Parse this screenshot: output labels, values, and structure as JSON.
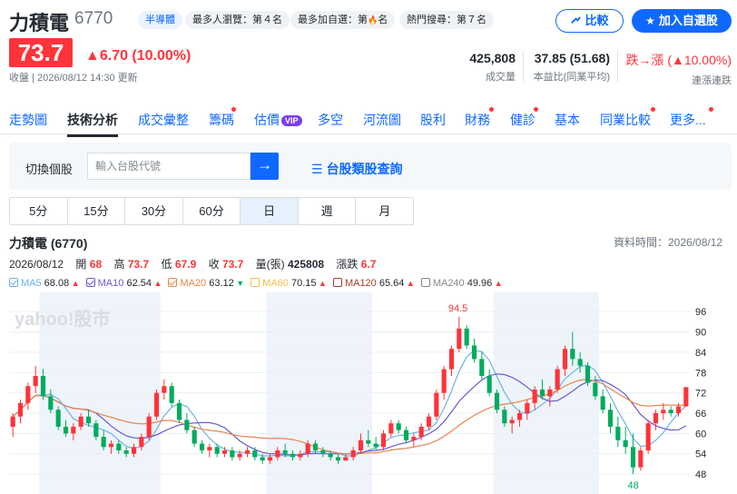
{
  "header": {
    "name": "力積電",
    "ticker": "6770",
    "badges": [
      "半導體",
      "最多人瀏覽：第４名",
      "最多加自選：第",
      "名",
      "熱門搜尋：第７名"
    ],
    "badge_fire_rank": "🔥",
    "compare_label": "比較",
    "watch_label": "加入自選股"
  },
  "quote": {
    "price": "73.7",
    "change": "▲6.70 (10.00%)",
    "close_info": "收盤 | 2026/08/12 14:30 更新",
    "stats": [
      {
        "value": "425,808",
        "label": "成交量"
      },
      {
        "value": "37.85 (51.68)",
        "label": "本益比(同業平均)"
      },
      {
        "value": "跌→漲 (▲10.00%)",
        "label": "連漲連跌"
      }
    ]
  },
  "tabs": [
    "走勢圖",
    "技術分析",
    "成交彙整",
    "籌碼",
    "估價",
    "多空",
    "河流圖",
    "股利",
    "財務",
    "健診",
    "基本",
    "同業比較",
    "更多..."
  ],
  "vip_label": "VIP",
  "search": {
    "label": "切換個股",
    "placeholder": "輸入台股代號",
    "category_link": "台股類股查詢"
  },
  "periods": [
    "5分",
    "15分",
    "30分",
    "60分",
    "日",
    "週",
    "月"
  ],
  "active_period": "日",
  "chart_info": {
    "title": "力積電 (6770)",
    "data_time": "資料時間：2026/08/12",
    "date": "2026/08/12",
    "open_label": "開",
    "open": "68",
    "high_label": "高",
    "high": "73.7",
    "low_label": "低",
    "low": "67.9",
    "close_label": "收",
    "close": "73.7",
    "volume_label": "量(張)",
    "volume": "425808",
    "change_label": "漲跌",
    "change": "6.7"
  },
  "ma_legend": [
    {
      "name": "MA5",
      "value": "68.08",
      "trend": "up",
      "color": "#6cb4e4",
      "checked": true
    },
    {
      "name": "MA10",
      "value": "62.54",
      "trend": "up",
      "color": "#6a5acd",
      "checked": true
    },
    {
      "name": "MA20",
      "value": "63.12",
      "trend": "down",
      "color": "#e4864c",
      "checked": true
    },
    {
      "name": "MA60",
      "value": "70.15",
      "trend": "up",
      "color": "#f2c14e",
      "checked": false
    },
    {
      "name": "MA120",
      "value": "65.64",
      "trend": "up",
      "color": "#a0402a",
      "checked": false
    },
    {
      "name": "MA240",
      "value": "49.96",
      "trend": "up",
      "color": "#888888",
      "checked": false
    }
  ],
  "watermark": "yahoo!股市",
  "colors": {
    "up": "#ff333a",
    "down": "#00ab5e",
    "accent": "#0f69ff"
  },
  "chart_data": {
    "type": "candlestick",
    "y_ticks": [
      96,
      90,
      84,
      78,
      72,
      66,
      60,
      54,
      48
    ],
    "ylim": [
      44,
      99
    ],
    "high_label": "94.5",
    "low_label": "48",
    "candles": [
      [
        62,
        66,
        59,
        65
      ],
      [
        65,
        70,
        63,
        69
      ],
      [
        69,
        75,
        67,
        74
      ],
      [
        74,
        80,
        72,
        77
      ],
      [
        77,
        79,
        70,
        71
      ],
      [
        71,
        73,
        66,
        67
      ],
      [
        67,
        68,
        61,
        62
      ],
      [
        62,
        64,
        59,
        60
      ],
      [
        60,
        63,
        58,
        62
      ],
      [
        62,
        66,
        61,
        65
      ],
      [
        65,
        67,
        62,
        63
      ],
      [
        63,
        64,
        58,
        59
      ],
      [
        59,
        61,
        55,
        56
      ],
      [
        56,
        58,
        54,
        57
      ],
      [
        57,
        58,
        54,
        55
      ],
      [
        55,
        56,
        53,
        54
      ],
      [
        54,
        57,
        53,
        56
      ],
      [
        56,
        60,
        55,
        59
      ],
      [
        59,
        66,
        58,
        65
      ],
      [
        65,
        73,
        64,
        72
      ],
      [
        72,
        76,
        70,
        74
      ],
      [
        74,
        75,
        68,
        69
      ],
      [
        69,
        70,
        63,
        64
      ],
      [
        64,
        66,
        60,
        61
      ],
      [
        61,
        62,
        56,
        57
      ],
      [
        57,
        58,
        54,
        55
      ],
      [
        55,
        57,
        53,
        56
      ],
      [
        56,
        57,
        53,
        54
      ],
      [
        54,
        56,
        53,
        55
      ],
      [
        55,
        56,
        52,
        53
      ],
      [
        53,
        55,
        52,
        54
      ],
      [
        54,
        56,
        53,
        55
      ],
      [
        55,
        56,
        52,
        53
      ],
      [
        53,
        54,
        51,
        52
      ],
      [
        52,
        54,
        51,
        53
      ],
      [
        53,
        56,
        52,
        55
      ],
      [
        55,
        57,
        53,
        54
      ],
      [
        54,
        55,
        52,
        53
      ],
      [
        53,
        55,
        52,
        54
      ],
      [
        54,
        58,
        53,
        57
      ],
      [
        57,
        58,
        54,
        55
      ],
      [
        55,
        56,
        53,
        54
      ],
      [
        54,
        55,
        52,
        53
      ],
      [
        53,
        54,
        51,
        52
      ],
      [
        52,
        54,
        52,
        53
      ],
      [
        53,
        56,
        52,
        55
      ],
      [
        55,
        60,
        54,
        58
      ],
      [
        58,
        61,
        56,
        57
      ],
      [
        57,
        59,
        55,
        56
      ],
      [
        56,
        61,
        55,
        60
      ],
      [
        60,
        64,
        59,
        63
      ],
      [
        63,
        64,
        60,
        61
      ],
      [
        61,
        62,
        57,
        58
      ],
      [
        58,
        60,
        56,
        59
      ],
      [
        59,
        63,
        58,
        62
      ],
      [
        62,
        66,
        61,
        65
      ],
      [
        65,
        73,
        64,
        72
      ],
      [
        72,
        80,
        70,
        79
      ],
      [
        79,
        86,
        77,
        85
      ],
      [
        85,
        94.5,
        84,
        91
      ],
      [
        91,
        92,
        85,
        86
      ],
      [
        86,
        88,
        81,
        82
      ],
      [
        82,
        84,
        76,
        77
      ],
      [
        77,
        79,
        71,
        72
      ],
      [
        72,
        73,
        66,
        67
      ],
      [
        67,
        68,
        62,
        63
      ],
      [
        63,
        65,
        60,
        64
      ],
      [
        64,
        67,
        62,
        66
      ],
      [
        66,
        70,
        64,
        69
      ],
      [
        69,
        74,
        67,
        73
      ],
      [
        73,
        76,
        70,
        71
      ],
      [
        71,
        74,
        68,
        73
      ],
      [
        73,
        80,
        72,
        79
      ],
      [
        79,
        86,
        77,
        85
      ],
      [
        85,
        90,
        80,
        82
      ],
      [
        82,
        84,
        78,
        80
      ],
      [
        80,
        81,
        74,
        75
      ],
      [
        75,
        77,
        70,
        71
      ],
      [
        71,
        73,
        66,
        67
      ],
      [
        67,
        69,
        60,
        62
      ],
      [
        62,
        65,
        56,
        58
      ],
      [
        58,
        62,
        54,
        56
      ],
      [
        56,
        60,
        48,
        50
      ],
      [
        50,
        56,
        49,
        55
      ],
      [
        55,
        64,
        54,
        63
      ],
      [
        63,
        67,
        61,
        66
      ],
      [
        66,
        69,
        64,
        67
      ],
      [
        67,
        68,
        65,
        66
      ],
      [
        66,
        69,
        65,
        68
      ],
      [
        68,
        73.7,
        67.9,
        73.7
      ]
    ]
  }
}
